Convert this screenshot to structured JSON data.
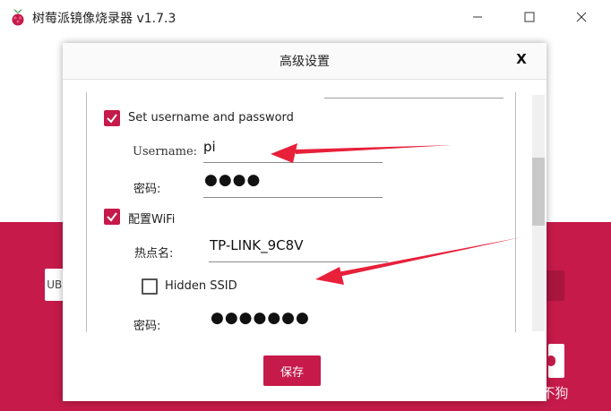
{
  "window": {
    "title": "树莓派镜像烧录器 v1.7.3",
    "min_icon": "minimize-icon",
    "max_icon": "maximize-icon",
    "close_icon": "close-icon"
  },
  "background": {
    "left_button_text": "UBU",
    "accent_color": "#c51a4a"
  },
  "dialog": {
    "title": "高级设置",
    "close_label": "X",
    "options": {
      "set_username": {
        "label": "Set username and password",
        "checked": true
      },
      "username_label": "Username:",
      "username_value": "pi",
      "password_label": "密码:",
      "password_value": "●●●●",
      "configure_wifi": {
        "label": "配置WiFi",
        "checked": true
      },
      "ssid_label": "热点名:",
      "ssid_value": "TP-LINK_9C8V",
      "hidden_ssid": {
        "label": "Hidden SSID",
        "checked": false
      },
      "wifi_password_label": "密码:",
      "wifi_password_value": "●●●●●●●"
    },
    "save_label": "保存"
  },
  "watermark": "CSDN @狗头狗不狗"
}
